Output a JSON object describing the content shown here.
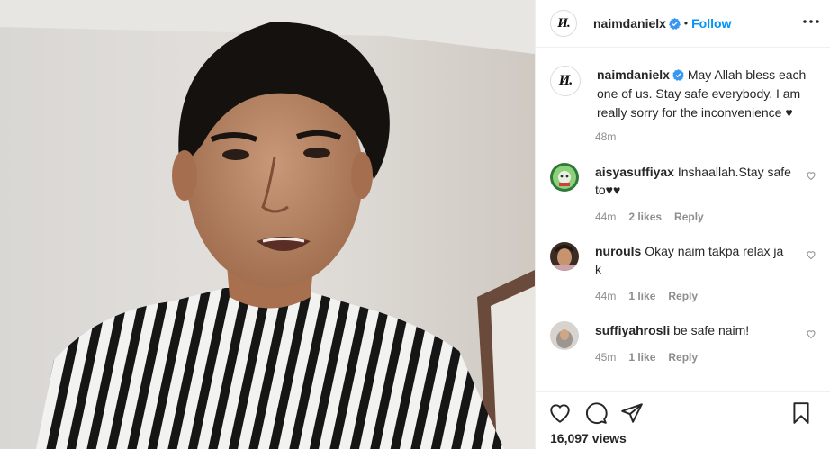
{
  "post": {
    "username": "naimdanielx",
    "follow_label": "Follow",
    "separator": "•",
    "avatar_logo_text": "И.",
    "caption": "May Allah bless each one of us. Stay safe everybody. I am really sorry for the inconvenience ♥",
    "caption_time": "48m",
    "views": "16,097 views"
  },
  "comments": [
    {
      "username": "aisyasuffiyax",
      "text": "Inshaallah.Stay safe to♥♥",
      "time": "44m",
      "likes": "2 likes",
      "reply": "Reply",
      "avatar_color": "#6fae5a"
    },
    {
      "username": "nurouls",
      "text": "Okay naim takpa relax ja k",
      "time": "44m",
      "likes": "1 like",
      "reply": "Reply",
      "avatar_color": "#5a4a3c"
    },
    {
      "username": "suffiyahrosli",
      "text": "be safe naim!",
      "time": "45m",
      "likes": "1 like",
      "reply": "Reply",
      "avatar_color": "#b9b3ae"
    }
  ],
  "icons": {
    "more": "more-options-icon",
    "verified": "verified-badge-icon",
    "like": "heart-icon",
    "comment": "comment-icon",
    "share": "share-icon",
    "save": "bookmark-icon"
  },
  "colors": {
    "accent": "#0095f6",
    "verified": "#3897f0",
    "muted": "#8e8e8e",
    "text": "#262626"
  }
}
